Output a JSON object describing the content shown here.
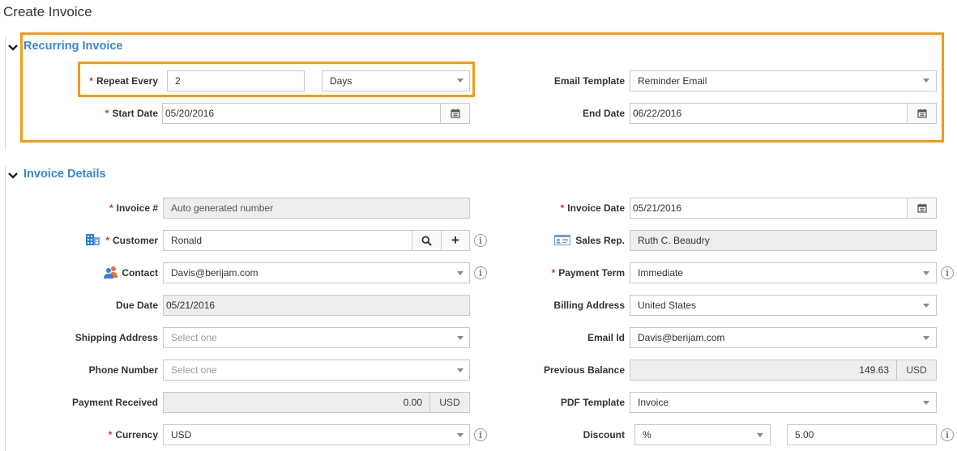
{
  "page": {
    "title": "Create Invoice"
  },
  "recurring": {
    "title": "Recurring Invoice",
    "repeat_every_label": "Repeat Every",
    "repeat_every_value": "2",
    "repeat_unit_value": "Days",
    "email_template_label": "Email Template",
    "email_template_value": "Reminder Email",
    "start_date_label": "Start Date",
    "start_date_value": "05/20/2016",
    "end_date_label": "End Date",
    "end_date_value": "06/22/2016"
  },
  "details": {
    "title": "Invoice Details",
    "invoice_no_label": "Invoice #",
    "invoice_no_placeholder": "Auto generated number",
    "invoice_date_label": "Invoice Date",
    "invoice_date_value": "05/21/2016",
    "customer_label": "Customer",
    "customer_value": "Ronald",
    "sales_rep_label": "Sales Rep.",
    "sales_rep_value": "Ruth C. Beaudry",
    "contact_label": "Contact",
    "contact_value": "Davis@berijam.com",
    "payment_term_label": "Payment Term",
    "payment_term_value": "Immediate",
    "due_date_label": "Due Date",
    "due_date_value": "05/21/2016",
    "billing_address_label": "Billing Address",
    "billing_address_value": "United States",
    "shipping_address_label": "Shipping Address",
    "shipping_address_placeholder": "Select one",
    "email_id_label": "Email Id",
    "email_id_value": "Davis@berijam.com",
    "phone_number_label": "Phone Number",
    "phone_number_placeholder": "Select one",
    "previous_balance_label": "Previous Balance",
    "previous_balance_value": "149.63",
    "previous_balance_currency": "USD",
    "payment_received_label": "Payment Received",
    "payment_received_value": "0.00",
    "payment_received_currency": "USD",
    "pdf_template_label": "PDF Template",
    "pdf_template_value": "Invoice",
    "currency_label": "Currency",
    "currency_value": "USD",
    "discount_label": "Discount",
    "discount_type_value": "%",
    "discount_value": "5.00"
  },
  "symbols": {
    "required": "*",
    "info": "i",
    "add": "+"
  },
  "colors": {
    "accent": "#3a87d7",
    "highlight": "#f39c12",
    "required": "#d9302c"
  }
}
